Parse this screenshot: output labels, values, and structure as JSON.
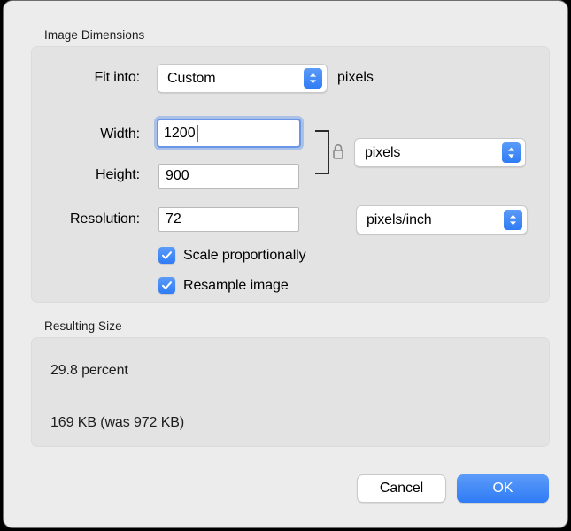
{
  "window": {
    "accent_color": "#2f7cf6",
    "background_color": "#ececec",
    "groupbox_color": "#e3e3e3"
  },
  "image_dimensions": {
    "group_label": "Image Dimensions",
    "fit_into": {
      "label": "Fit into:",
      "value": "Custom",
      "unit_suffix": "pixels"
    },
    "width": {
      "label": "Width:",
      "value": "1200",
      "focused": true
    },
    "height": {
      "label": "Height:",
      "value": "900"
    },
    "size_unit": {
      "value": "pixels"
    },
    "link_lock": {
      "state": "locked",
      "icon": "lock-closed-icon"
    },
    "resolution": {
      "label": "Resolution:",
      "value": "72",
      "unit": "pixels/inch"
    },
    "options": [
      {
        "label": "Scale proportionally",
        "checked": true
      },
      {
        "label": "Resample image",
        "checked": true
      }
    ]
  },
  "resulting_size": {
    "group_label": "Resulting Size",
    "percent_line": "29.8 percent",
    "size_line": "169 KB (was 972 KB)"
  },
  "actions": {
    "cancel_label": "Cancel",
    "ok_label": "OK"
  }
}
